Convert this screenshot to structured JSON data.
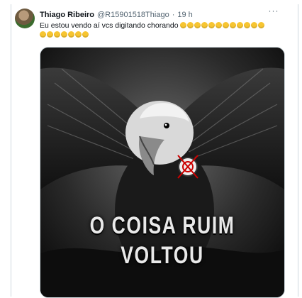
{
  "tweet": {
    "author_name": "Thiago Ribeiro",
    "handle": "@R15901518Thiago",
    "separator": "·",
    "time": "19 h",
    "more_label": "···",
    "text": "Eu estou vendo aí vcs digitando chorando",
    "laugh_count_line1": 12,
    "laugh_count_line2": 7
  },
  "media": {
    "line1": "O COISA RUIM",
    "line2": "VOLTOU"
  }
}
